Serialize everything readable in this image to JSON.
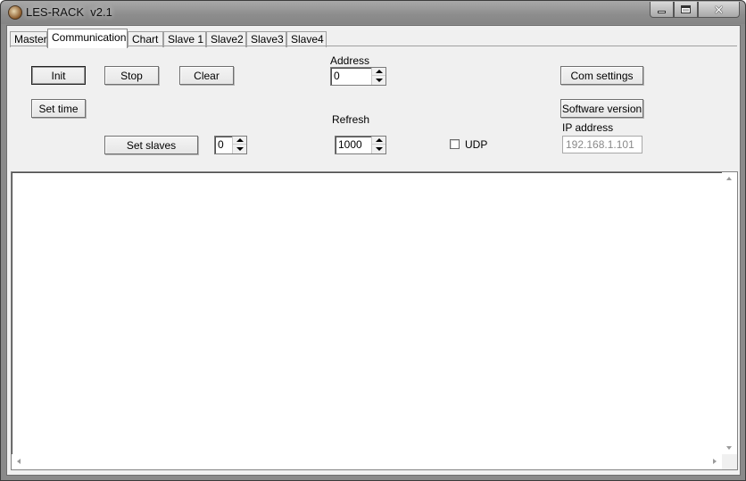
{
  "window": {
    "title": "LES-RACK  v2.1",
    "icon": "app-logo-icon",
    "controls": {
      "minimize": "minimize-icon",
      "maximize": "maximize-icon",
      "close": "close-icon",
      "close_glyph": "✕"
    }
  },
  "tabs": [
    {
      "label": "Master",
      "active": false
    },
    {
      "label": "Communication",
      "active": true
    },
    {
      "label": "Chart",
      "active": false
    },
    {
      "label": "Slave 1",
      "active": false
    },
    {
      "label": "Slave2",
      "active": false
    },
    {
      "label": "Slave3",
      "active": false
    },
    {
      "label": "Slave4",
      "active": false
    }
  ],
  "communication": {
    "init_label": "Init",
    "stop_label": "Stop",
    "clear_label": "Clear",
    "set_time_label": "Set time",
    "set_slaves_label": "Set slaves",
    "slaves_value": "0",
    "address_label": "Address",
    "address_value": "0",
    "refresh_label": "Refresh",
    "refresh_value": "1000",
    "udp_label": "UDP",
    "udp_checked": false,
    "com_settings_label": "Com settings",
    "software_version_label": "Software version",
    "ip_label": "IP address",
    "ip_value": "192.168.1.101"
  },
  "log": {
    "content": ""
  }
}
